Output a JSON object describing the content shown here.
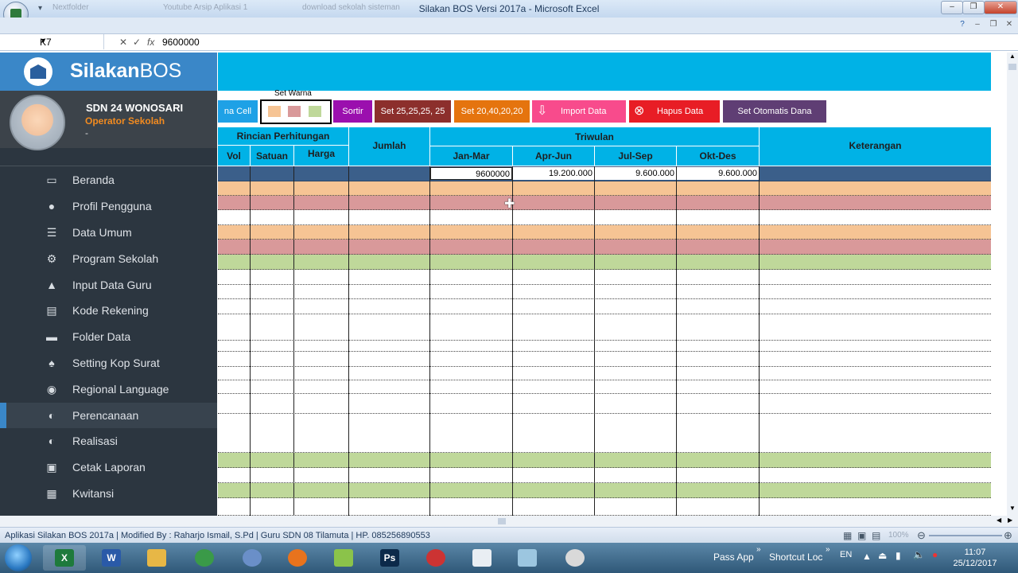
{
  "window": {
    "title": "Silakan BOS Versi 2017a - Microsoft Excel",
    "ghost_tabs": [
      "Nextfolder",
      "Youtube Arsip Aplikasi 1",
      "download sekolah sisteman"
    ]
  },
  "formula_bar": {
    "name_box": "K7",
    "formula": "9600000"
  },
  "sidebar": {
    "brand_bold": "Silakan",
    "brand_thin": "BOS",
    "school": "SDN 24 WONOSARI",
    "role": "Operator Sekolah",
    "subtitle": "-",
    "items": [
      {
        "label": "Beranda",
        "icon": "monitor-icon"
      },
      {
        "label": "Profil Pengguna",
        "icon": "user-icon"
      },
      {
        "label": "Data Umum",
        "icon": "list-icon"
      },
      {
        "label": "Program Sekolah",
        "icon": "gear-icon"
      },
      {
        "label": "Input Data Guru",
        "icon": "graduation-cap-icon"
      },
      {
        "label": "Kode Rekening",
        "icon": "book-icon"
      },
      {
        "label": "Folder Data",
        "icon": "folder-icon"
      },
      {
        "label": "Setting Kop Surat",
        "icon": "signpost-icon"
      },
      {
        "label": "Regional Language",
        "icon": "globe-icon"
      },
      {
        "label": "Perencanaan",
        "icon": "chart-icon",
        "active": true
      },
      {
        "label": "Realisasi",
        "icon": "chart-icon"
      },
      {
        "label": "Cetak Laporan",
        "icon": "printer-icon"
      },
      {
        "label": "Kwitansi",
        "icon": "receipt-icon"
      }
    ]
  },
  "toolbar": {
    "warna_cell_label": "na Cell",
    "set_warna_label": "Set Warna",
    "swatches": [
      "#f6c494",
      "#d9999a",
      "#bfd89a"
    ],
    "sortir": "Sortir",
    "set_a": "Set 25,25,25, 25",
    "set_b": "Set 20,40,20,20",
    "import": "Import Data",
    "hapus": "Hapus Data",
    "otomatis": "Set Otomatis Dana"
  },
  "table": {
    "header_rincian": "Rincian Perhitungan",
    "col_vol": "Vol",
    "col_satuan": "Satuan",
    "col_harga": "Harga",
    "col_jumlah": "Jumlah",
    "header_triwulan": "Triwulan",
    "col_q1": "Jan-Mar",
    "col_q2": "Apr-Jun",
    "col_q3": "Jul-Sep",
    "col_q4": "Okt-Des",
    "col_keterangan": "Keterangan",
    "first_row": {
      "q1": "9600000",
      "q2": "19.200.000",
      "q3": "9.600.000",
      "q4": "9.600.000"
    }
  },
  "status_bar": {
    "text": "Aplikasi Silakan BOS 2017a | Modified By : Raharjo Ismail, S.Pd | Guru SDN 08 Tilamuta | HP. 085256890553",
    "zoom": "100%"
  },
  "taskbar": {
    "pass_app": "Pass App",
    "shortcut": "Shortcut Loc",
    "lang": "EN",
    "time": "11:07",
    "date": "25/12/2017"
  },
  "colors": {
    "accent_cyan": "#00b2e6",
    "sidebar_bg": "#2c3640",
    "brand_blue": "#3a87c8",
    "row_orange": "#f6c494",
    "row_pink": "#d9999a",
    "row_green": "#bfd89a",
    "row_navy": "#3b5f8a"
  }
}
